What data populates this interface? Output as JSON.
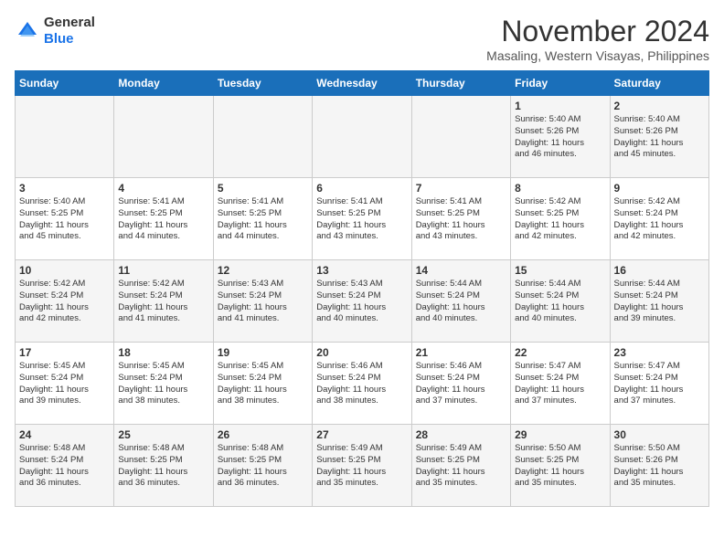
{
  "logo": {
    "general": "General",
    "blue": "Blue"
  },
  "title": "November 2024",
  "location": "Masaling, Western Visayas, Philippines",
  "weekdays": [
    "Sunday",
    "Monday",
    "Tuesday",
    "Wednesday",
    "Thursday",
    "Friday",
    "Saturday"
  ],
  "weeks": [
    [
      {
        "day": "",
        "info": ""
      },
      {
        "day": "",
        "info": ""
      },
      {
        "day": "",
        "info": ""
      },
      {
        "day": "",
        "info": ""
      },
      {
        "day": "",
        "info": ""
      },
      {
        "day": "1",
        "info": "Sunrise: 5:40 AM\nSunset: 5:26 PM\nDaylight: 11 hours\nand 46 minutes."
      },
      {
        "day": "2",
        "info": "Sunrise: 5:40 AM\nSunset: 5:26 PM\nDaylight: 11 hours\nand 45 minutes."
      }
    ],
    [
      {
        "day": "3",
        "info": "Sunrise: 5:40 AM\nSunset: 5:25 PM\nDaylight: 11 hours\nand 45 minutes."
      },
      {
        "day": "4",
        "info": "Sunrise: 5:41 AM\nSunset: 5:25 PM\nDaylight: 11 hours\nand 44 minutes."
      },
      {
        "day": "5",
        "info": "Sunrise: 5:41 AM\nSunset: 5:25 PM\nDaylight: 11 hours\nand 44 minutes."
      },
      {
        "day": "6",
        "info": "Sunrise: 5:41 AM\nSunset: 5:25 PM\nDaylight: 11 hours\nand 43 minutes."
      },
      {
        "day": "7",
        "info": "Sunrise: 5:41 AM\nSunset: 5:25 PM\nDaylight: 11 hours\nand 43 minutes."
      },
      {
        "day": "8",
        "info": "Sunrise: 5:42 AM\nSunset: 5:25 PM\nDaylight: 11 hours\nand 42 minutes."
      },
      {
        "day": "9",
        "info": "Sunrise: 5:42 AM\nSunset: 5:24 PM\nDaylight: 11 hours\nand 42 minutes."
      }
    ],
    [
      {
        "day": "10",
        "info": "Sunrise: 5:42 AM\nSunset: 5:24 PM\nDaylight: 11 hours\nand 42 minutes."
      },
      {
        "day": "11",
        "info": "Sunrise: 5:42 AM\nSunset: 5:24 PM\nDaylight: 11 hours\nand 41 minutes."
      },
      {
        "day": "12",
        "info": "Sunrise: 5:43 AM\nSunset: 5:24 PM\nDaylight: 11 hours\nand 41 minutes."
      },
      {
        "day": "13",
        "info": "Sunrise: 5:43 AM\nSunset: 5:24 PM\nDaylight: 11 hours\nand 40 minutes."
      },
      {
        "day": "14",
        "info": "Sunrise: 5:44 AM\nSunset: 5:24 PM\nDaylight: 11 hours\nand 40 minutes."
      },
      {
        "day": "15",
        "info": "Sunrise: 5:44 AM\nSunset: 5:24 PM\nDaylight: 11 hours\nand 40 minutes."
      },
      {
        "day": "16",
        "info": "Sunrise: 5:44 AM\nSunset: 5:24 PM\nDaylight: 11 hours\nand 39 minutes."
      }
    ],
    [
      {
        "day": "17",
        "info": "Sunrise: 5:45 AM\nSunset: 5:24 PM\nDaylight: 11 hours\nand 39 minutes."
      },
      {
        "day": "18",
        "info": "Sunrise: 5:45 AM\nSunset: 5:24 PM\nDaylight: 11 hours\nand 38 minutes."
      },
      {
        "day": "19",
        "info": "Sunrise: 5:45 AM\nSunset: 5:24 PM\nDaylight: 11 hours\nand 38 minutes."
      },
      {
        "day": "20",
        "info": "Sunrise: 5:46 AM\nSunset: 5:24 PM\nDaylight: 11 hours\nand 38 minutes."
      },
      {
        "day": "21",
        "info": "Sunrise: 5:46 AM\nSunset: 5:24 PM\nDaylight: 11 hours\nand 37 minutes."
      },
      {
        "day": "22",
        "info": "Sunrise: 5:47 AM\nSunset: 5:24 PM\nDaylight: 11 hours\nand 37 minutes."
      },
      {
        "day": "23",
        "info": "Sunrise: 5:47 AM\nSunset: 5:24 PM\nDaylight: 11 hours\nand 37 minutes."
      }
    ],
    [
      {
        "day": "24",
        "info": "Sunrise: 5:48 AM\nSunset: 5:24 PM\nDaylight: 11 hours\nand 36 minutes."
      },
      {
        "day": "25",
        "info": "Sunrise: 5:48 AM\nSunset: 5:25 PM\nDaylight: 11 hours\nand 36 minutes."
      },
      {
        "day": "26",
        "info": "Sunrise: 5:48 AM\nSunset: 5:25 PM\nDaylight: 11 hours\nand 36 minutes."
      },
      {
        "day": "27",
        "info": "Sunrise: 5:49 AM\nSunset: 5:25 PM\nDaylight: 11 hours\nand 35 minutes."
      },
      {
        "day": "28",
        "info": "Sunrise: 5:49 AM\nSunset: 5:25 PM\nDaylight: 11 hours\nand 35 minutes."
      },
      {
        "day": "29",
        "info": "Sunrise: 5:50 AM\nSunset: 5:25 PM\nDaylight: 11 hours\nand 35 minutes."
      },
      {
        "day": "30",
        "info": "Sunrise: 5:50 AM\nSunset: 5:26 PM\nDaylight: 11 hours\nand 35 minutes."
      }
    ]
  ]
}
